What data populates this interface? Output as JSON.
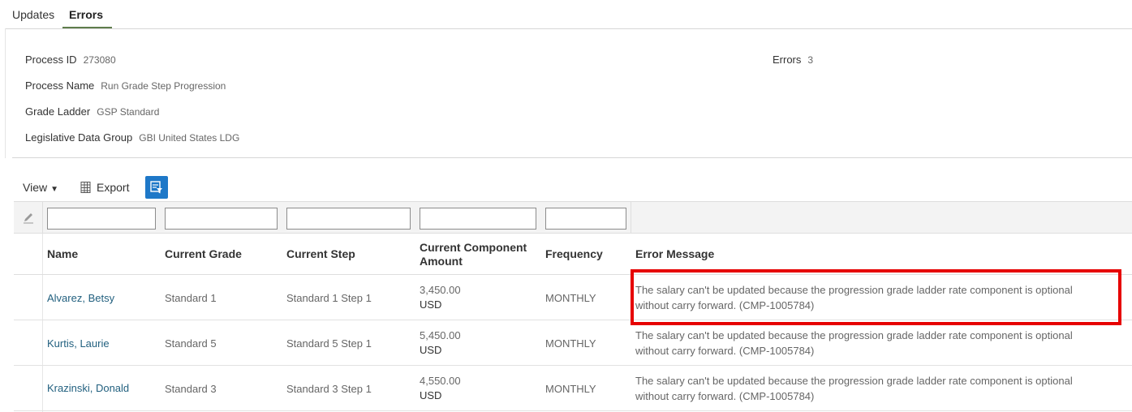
{
  "tabs": [
    {
      "label": "Updates",
      "active": false
    },
    {
      "label": "Errors",
      "active": true
    }
  ],
  "info": {
    "process_id_label": "Process ID",
    "process_id_value": "273080",
    "process_name_label": "Process Name",
    "process_name_value": "Run Grade Step Progression",
    "grade_ladder_label": "Grade Ladder",
    "grade_ladder_value": "GSP Standard",
    "ldg_label": "Legislative Data Group",
    "ldg_value": "GBI United States LDG",
    "errors_label": "Errors",
    "errors_value": "3"
  },
  "toolbar": {
    "view_label": "View",
    "export_label": "Export",
    "filter_icon": "query-by-example-icon"
  },
  "table": {
    "columns": [
      {
        "label": "Name"
      },
      {
        "label": "Current Grade"
      },
      {
        "label": "Current Step"
      },
      {
        "label": "Current Component Amount"
      },
      {
        "label": "Frequency"
      },
      {
        "label": "Error Message"
      }
    ],
    "current_component_line1": "Current Component",
    "current_component_line2": "Amount",
    "filters": [
      "",
      "",
      "",
      "",
      ""
    ],
    "rows": [
      {
        "name": "Alvarez, Betsy",
        "grade": "Standard 1",
        "step": "Standard 1 Step 1",
        "amount": "3,450.00",
        "currency": "USD",
        "frequency": "MONTHLY",
        "error_line1": "The salary can't be updated because the progression grade ladder rate component is optional",
        "error_line2": "without carry forward. (CMP-1005784)"
      },
      {
        "name": "Kurtis, Laurie",
        "grade": "Standard 5",
        "step": "Standard 5 Step 1",
        "amount": "5,450.00",
        "currency": "USD",
        "frequency": "MONTHLY",
        "error_line1": "The salary can't be updated because the progression grade ladder rate component is optional",
        "error_line2": "without carry forward. (CMP-1005784)"
      },
      {
        "name": "Krazinski, Donald",
        "grade": "Standard 3",
        "step": "Standard 3 Step 1",
        "amount": "4,550.00",
        "currency": "USD",
        "frequency": "MONTHLY",
        "error_line1": "The salary can't be updated because the progression grade ladder rate component is optional",
        "error_line2": "without carry forward. (CMP-1005784)"
      }
    ]
  },
  "colors": {
    "active_tab_underline": "#5f7d4c",
    "link": "#22607f",
    "filter_button": "#1e78c8",
    "highlight": "#e60000"
  }
}
